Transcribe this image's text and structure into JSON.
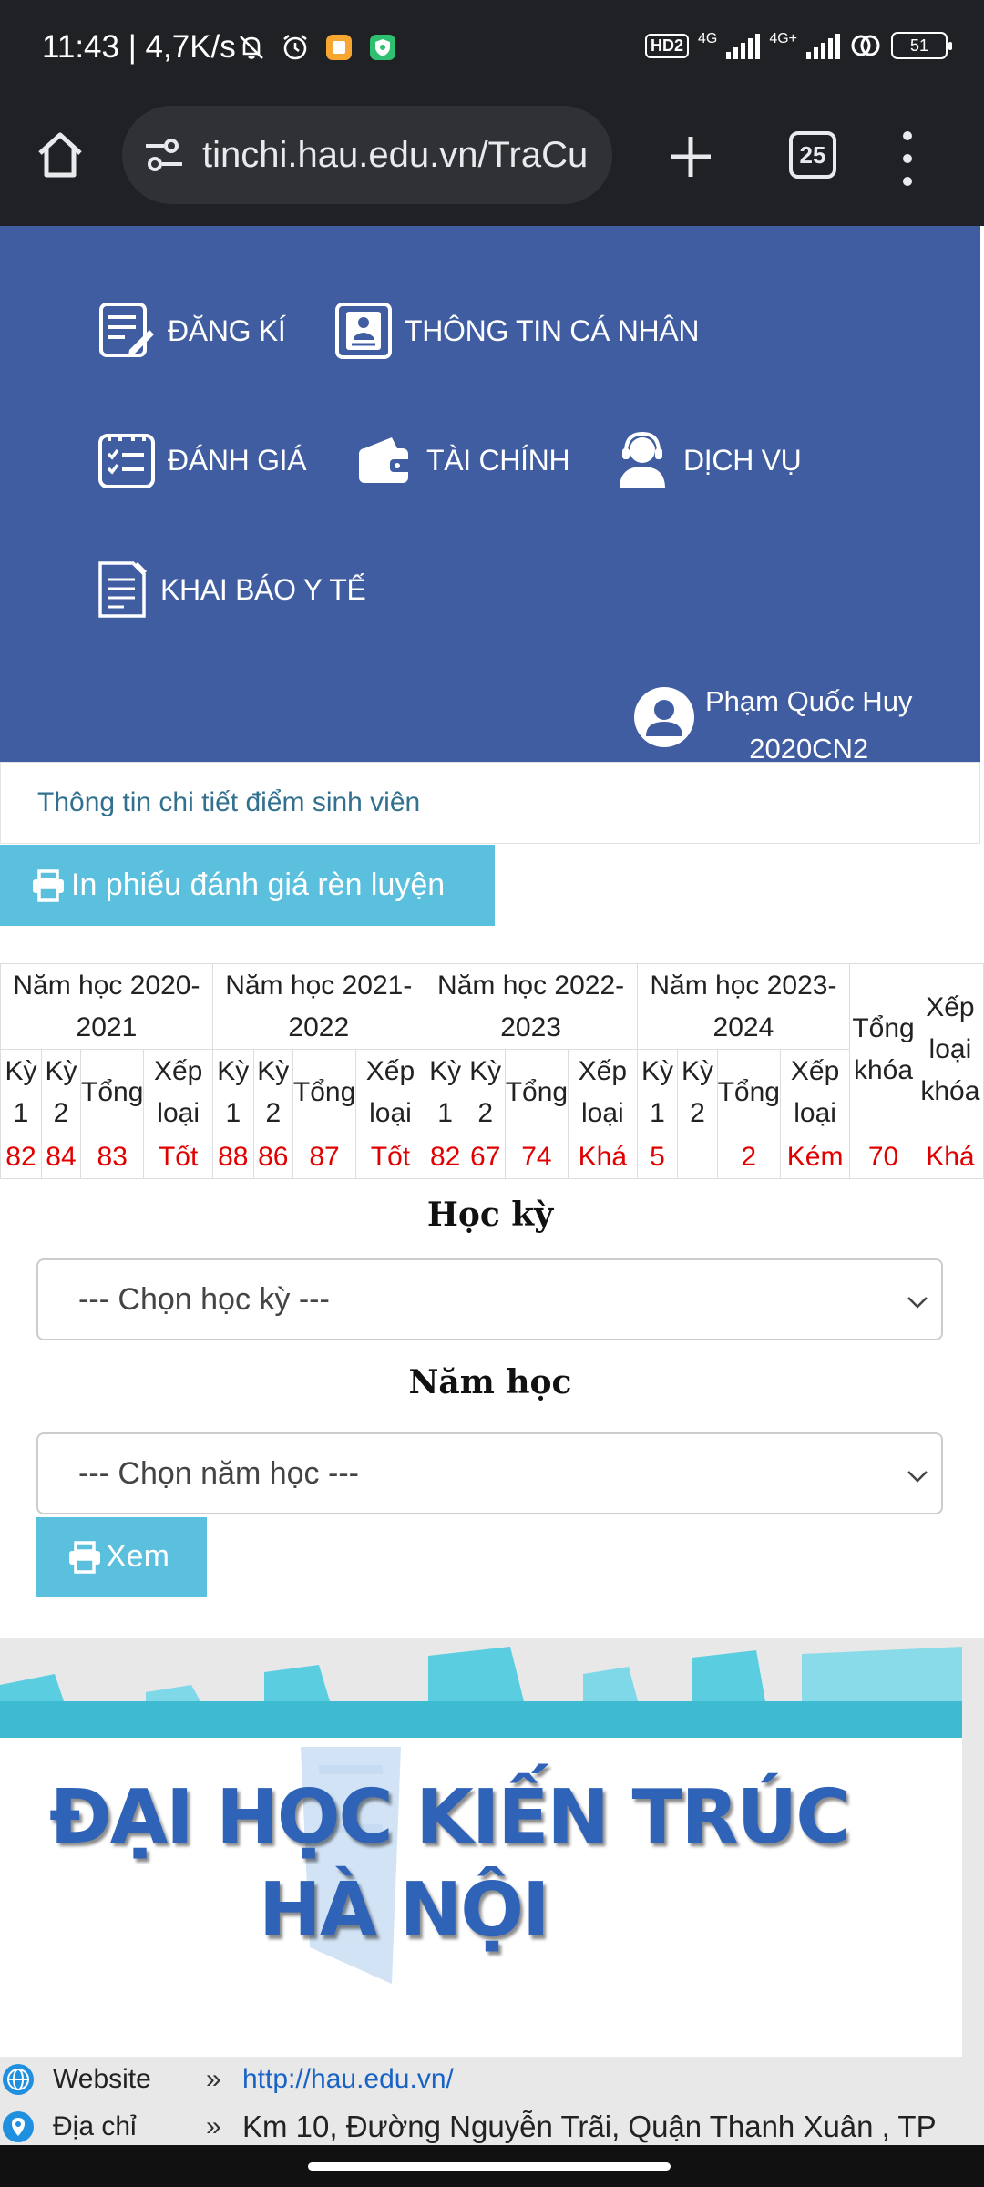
{
  "status_bar": {
    "time": "11:43",
    "speed": "4,7K/s",
    "hd_badge": "HD2",
    "net1": "4G",
    "net2": "4G+",
    "battery": "51",
    "icons": [
      "mute-icon",
      "alarm-icon",
      "notes-app-icon",
      "vpn-shield-icon",
      "hd-voice-icon",
      "signal-icon",
      "signal-icon",
      "link-icon",
      "battery-icon"
    ]
  },
  "browser": {
    "url": "tinchi.hau.edu.vn/TraCu",
    "tab_count": "25",
    "icons": [
      "home-icon",
      "site-settings-icon",
      "plus-icon",
      "tabs-icon",
      "more-menu-icon"
    ]
  },
  "nav": {
    "items": [
      {
        "label": "ĐĂNG KÍ",
        "icon": "register-form-icon"
      },
      {
        "label": "THÔNG TIN CÁ NHÂN",
        "icon": "profile-card-icon"
      },
      {
        "label": "ĐÁNH GIÁ",
        "icon": "checklist-icon"
      },
      {
        "label": "TÀI CHÍNH",
        "icon": "wallet-icon"
      },
      {
        "label": "DỊCH VỤ",
        "icon": "support-agent-icon"
      },
      {
        "label": "KHAI BÁO Y TẾ",
        "icon": "health-declaration-icon"
      }
    ],
    "user_name": "Phạm Quốc Huy",
    "user_class": "2020CN2"
  },
  "panel_heading": "Thông tin chi tiết điểm sinh viên",
  "print_button": "In phiếu đánh giá rèn luyện",
  "scores": {
    "years": [
      "Năm học 2020-2021",
      "Năm học 2021-2022",
      "Năm học 2022-2023",
      "Năm học 2023-2024"
    ],
    "sub_headers": [
      "Kỳ 1",
      "Kỳ 2",
      "Tổng",
      "Xếp loại"
    ],
    "total_header": "Tổng khóa",
    "rank_header": "Xếp loại khóa",
    "values": [
      {
        "ky1": "82",
        "ky2": "84",
        "tong": "83",
        "xep_loai": "Tốt"
      },
      {
        "ky1": "88",
        "ky2": "86",
        "tong": "87",
        "xep_loai": "Tốt"
      },
      {
        "ky1": "82",
        "ky2": "67",
        "tong": "74",
        "xep_loai": "Khá"
      },
      {
        "ky1": "5",
        "ky2": "",
        "tong": "2",
        "xep_loai": "Kém"
      }
    ],
    "total": "70",
    "rank": "Khá",
    "value_color": "#e00000"
  },
  "filters": {
    "semester_label": "Học kỳ",
    "semester_selected": "--- Chọn học kỳ ---",
    "year_label": "Năm học",
    "year_selected": "--- Chọn năm học ---",
    "view_button": "Xem"
  },
  "footer": {
    "logo_line1": "ĐẠI HỌC KIẾN TRÚC",
    "logo_line2": "HÀ NỘI",
    "website_label": "Website",
    "website_value": "http://hau.edu.vn/",
    "address_label": "Địa chỉ",
    "address_value": "Km 10, Đường Nguyễn Trãi, Quận Thanh Xuân , TP",
    "arrow": "»"
  },
  "colors": {
    "nav_blue": "#3f5da0",
    "button_cyan": "#5bc0de",
    "heading_text": "#31708f",
    "link_blue": "#1a63c6"
  }
}
